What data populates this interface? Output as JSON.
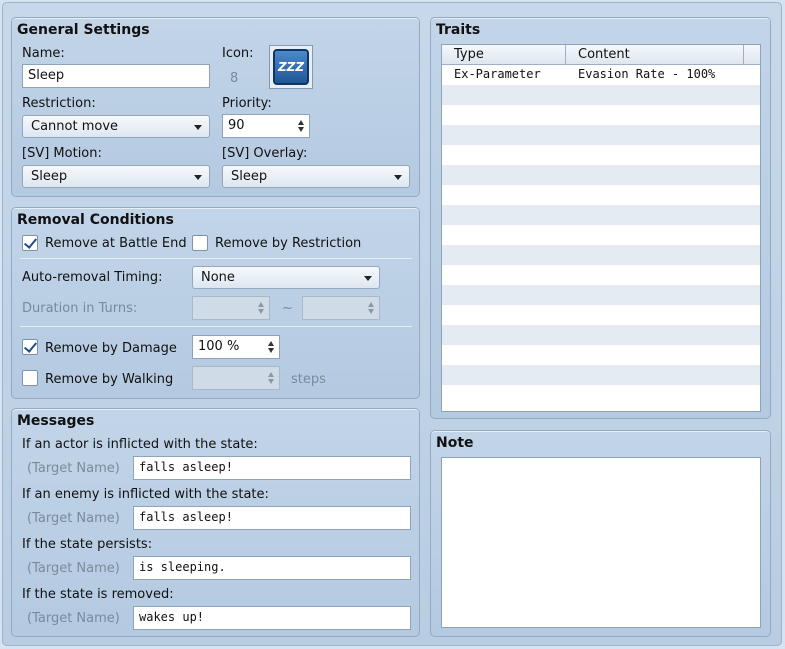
{
  "general": {
    "title": "General Settings",
    "name_label": "Name:",
    "name_value": "Sleep",
    "icon_label": "Icon:",
    "icon_index": "8",
    "icon_glyph": "ZZZ",
    "restriction_label": "Restriction:",
    "restriction_value": "Cannot move",
    "priority_label": "Priority:",
    "priority_value": "90",
    "motion_label": "[SV] Motion:",
    "motion_value": "Sleep",
    "overlay_label": "[SV] Overlay:",
    "overlay_value": "Sleep"
  },
  "removal": {
    "title": "Removal Conditions",
    "battle_end_label": "Remove at Battle End",
    "battle_end_checked": true,
    "restriction_label": "Remove by Restriction",
    "restriction_checked": false,
    "timing_label": "Auto-removal Timing:",
    "timing_value": "None",
    "duration_label": "Duration in Turns:",
    "tilde": "~",
    "damage_label": "Remove by Damage",
    "damage_checked": true,
    "damage_value": "100 %",
    "walking_label": "Remove by Walking",
    "walking_checked": false,
    "steps_label": "steps"
  },
  "messages": {
    "title": "Messages",
    "target_placeholder": "(Target Name)",
    "actor_label": "If an actor is inflicted with the state:",
    "actor_value": "falls asleep!",
    "enemy_label": "If an enemy is inflicted with the state:",
    "enemy_value": "falls asleep!",
    "persist_label": "If the state persists:",
    "persist_value": "is sleeping.",
    "removed_label": "If the state is removed:",
    "removed_value": "wakes up!"
  },
  "traits": {
    "title": "Traits",
    "columns": [
      "Type",
      "Content"
    ],
    "rows": [
      {
        "type": "Ex-Parameter",
        "content": "Evasion Rate - 100%"
      }
    ]
  },
  "note": {
    "title": "Note",
    "value": ""
  }
}
